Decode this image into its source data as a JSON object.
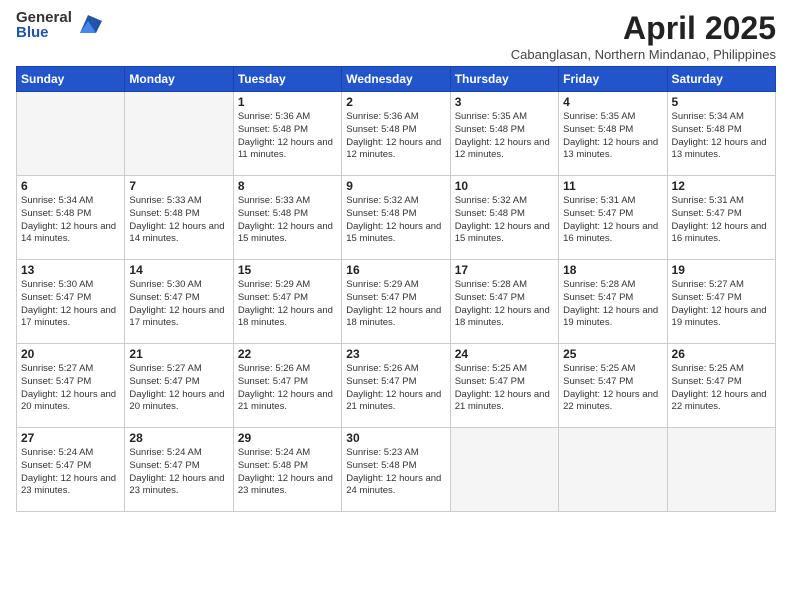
{
  "logo": {
    "general": "General",
    "blue": "Blue"
  },
  "title": "April 2025",
  "subtitle": "Cabanglasan, Northern Mindanao, Philippines",
  "days_of_week": [
    "Sunday",
    "Monday",
    "Tuesday",
    "Wednesday",
    "Thursday",
    "Friday",
    "Saturday"
  ],
  "weeks": [
    [
      {
        "day": "",
        "empty": true
      },
      {
        "day": "",
        "empty": true
      },
      {
        "day": "1",
        "sunrise": "5:36 AM",
        "sunset": "5:48 PM",
        "daylight": "12 hours and 11 minutes."
      },
      {
        "day": "2",
        "sunrise": "5:36 AM",
        "sunset": "5:48 PM",
        "daylight": "12 hours and 12 minutes."
      },
      {
        "day": "3",
        "sunrise": "5:35 AM",
        "sunset": "5:48 PM",
        "daylight": "12 hours and 12 minutes."
      },
      {
        "day": "4",
        "sunrise": "5:35 AM",
        "sunset": "5:48 PM",
        "daylight": "12 hours and 13 minutes."
      },
      {
        "day": "5",
        "sunrise": "5:34 AM",
        "sunset": "5:48 PM",
        "daylight": "12 hours and 13 minutes."
      }
    ],
    [
      {
        "day": "6",
        "sunrise": "5:34 AM",
        "sunset": "5:48 PM",
        "daylight": "12 hours and 14 minutes."
      },
      {
        "day": "7",
        "sunrise": "5:33 AM",
        "sunset": "5:48 PM",
        "daylight": "12 hours and 14 minutes."
      },
      {
        "day": "8",
        "sunrise": "5:33 AM",
        "sunset": "5:48 PM",
        "daylight": "12 hours and 15 minutes."
      },
      {
        "day": "9",
        "sunrise": "5:32 AM",
        "sunset": "5:48 PM",
        "daylight": "12 hours and 15 minutes."
      },
      {
        "day": "10",
        "sunrise": "5:32 AM",
        "sunset": "5:48 PM",
        "daylight": "12 hours and 15 minutes."
      },
      {
        "day": "11",
        "sunrise": "5:31 AM",
        "sunset": "5:47 PM",
        "daylight": "12 hours and 16 minutes."
      },
      {
        "day": "12",
        "sunrise": "5:31 AM",
        "sunset": "5:47 PM",
        "daylight": "12 hours and 16 minutes."
      }
    ],
    [
      {
        "day": "13",
        "sunrise": "5:30 AM",
        "sunset": "5:47 PM",
        "daylight": "12 hours and 17 minutes."
      },
      {
        "day": "14",
        "sunrise": "5:30 AM",
        "sunset": "5:47 PM",
        "daylight": "12 hours and 17 minutes."
      },
      {
        "day": "15",
        "sunrise": "5:29 AM",
        "sunset": "5:47 PM",
        "daylight": "12 hours and 18 minutes."
      },
      {
        "day": "16",
        "sunrise": "5:29 AM",
        "sunset": "5:47 PM",
        "daylight": "12 hours and 18 minutes."
      },
      {
        "day": "17",
        "sunrise": "5:28 AM",
        "sunset": "5:47 PM",
        "daylight": "12 hours and 18 minutes."
      },
      {
        "day": "18",
        "sunrise": "5:28 AM",
        "sunset": "5:47 PM",
        "daylight": "12 hours and 19 minutes."
      },
      {
        "day": "19",
        "sunrise": "5:27 AM",
        "sunset": "5:47 PM",
        "daylight": "12 hours and 19 minutes."
      }
    ],
    [
      {
        "day": "20",
        "sunrise": "5:27 AM",
        "sunset": "5:47 PM",
        "daylight": "12 hours and 20 minutes."
      },
      {
        "day": "21",
        "sunrise": "5:27 AM",
        "sunset": "5:47 PM",
        "daylight": "12 hours and 20 minutes."
      },
      {
        "day": "22",
        "sunrise": "5:26 AM",
        "sunset": "5:47 PM",
        "daylight": "12 hours and 21 minutes."
      },
      {
        "day": "23",
        "sunrise": "5:26 AM",
        "sunset": "5:47 PM",
        "daylight": "12 hours and 21 minutes."
      },
      {
        "day": "24",
        "sunrise": "5:25 AM",
        "sunset": "5:47 PM",
        "daylight": "12 hours and 21 minutes."
      },
      {
        "day": "25",
        "sunrise": "5:25 AM",
        "sunset": "5:47 PM",
        "daylight": "12 hours and 22 minutes."
      },
      {
        "day": "26",
        "sunrise": "5:25 AM",
        "sunset": "5:47 PM",
        "daylight": "12 hours and 22 minutes."
      }
    ],
    [
      {
        "day": "27",
        "sunrise": "5:24 AM",
        "sunset": "5:47 PM",
        "daylight": "12 hours and 23 minutes."
      },
      {
        "day": "28",
        "sunrise": "5:24 AM",
        "sunset": "5:47 PM",
        "daylight": "12 hours and 23 minutes."
      },
      {
        "day": "29",
        "sunrise": "5:24 AM",
        "sunset": "5:48 PM",
        "daylight": "12 hours and 23 minutes."
      },
      {
        "day": "30",
        "sunrise": "5:23 AM",
        "sunset": "5:48 PM",
        "daylight": "12 hours and 24 minutes."
      },
      {
        "day": "",
        "empty": true
      },
      {
        "day": "",
        "empty": true
      },
      {
        "day": "",
        "empty": true
      }
    ]
  ]
}
